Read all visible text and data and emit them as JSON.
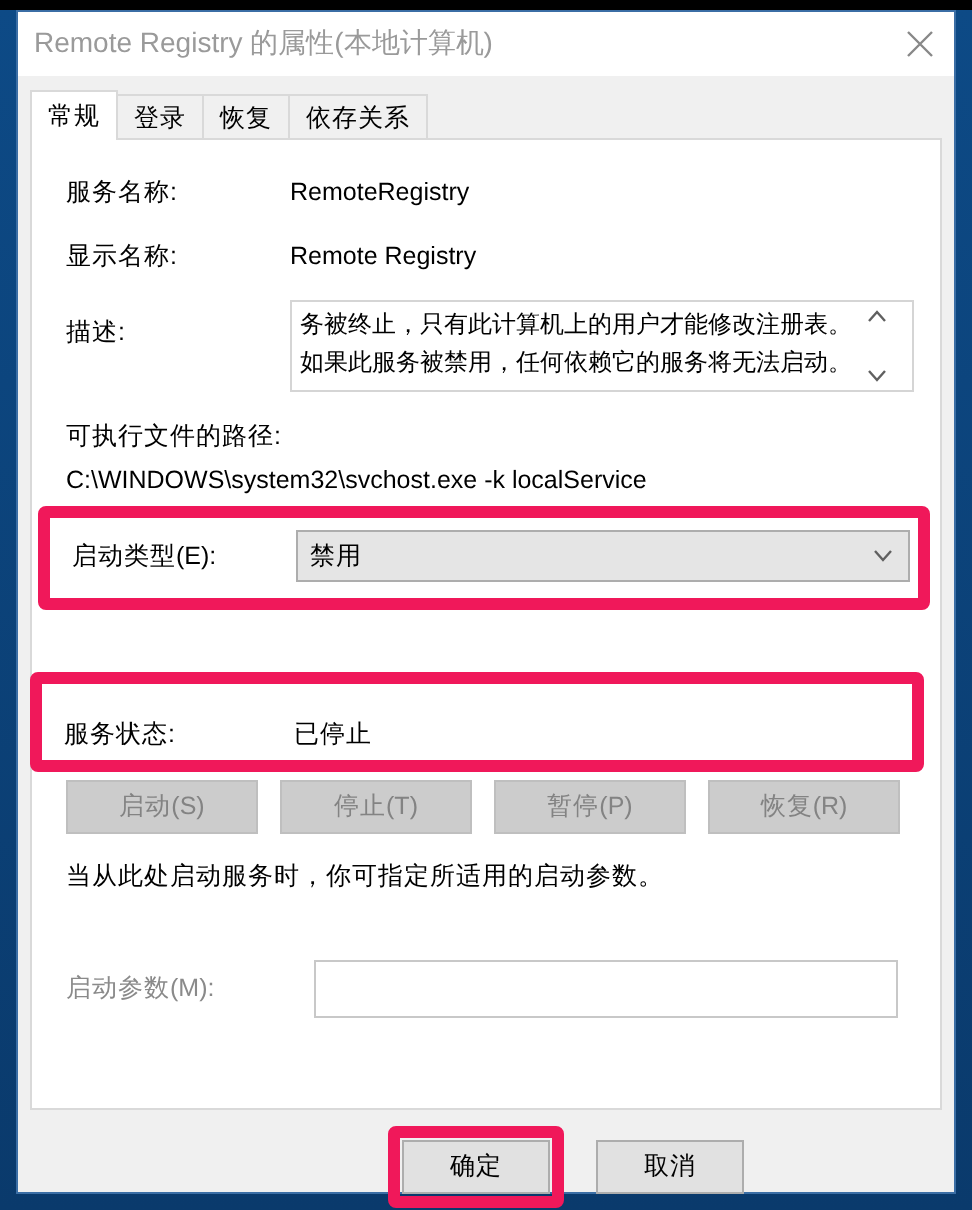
{
  "window": {
    "title": "Remote Registry 的属性(本地计算机)"
  },
  "tabs": [
    {
      "label": "常规",
      "selected": true
    },
    {
      "label": "登录",
      "selected": false
    },
    {
      "label": "恢复",
      "selected": false
    },
    {
      "label": "依存关系",
      "selected": false
    }
  ],
  "service_name": {
    "label": "服务名称:",
    "value": "RemoteRegistry"
  },
  "display_name": {
    "label": "显示名称:",
    "value": "Remote Registry"
  },
  "description": {
    "label": "描述:",
    "value": "务被终止，只有此计算机上的用户才能修改注册表。如果此服务被禁用，任何依赖它的服务将无法启动。"
  },
  "executable_path": {
    "label": "可执行文件的路径:",
    "value": "C:\\WINDOWS\\system32\\svchost.exe -k localService"
  },
  "startup_type": {
    "label": "启动类型(E):",
    "value": "禁用",
    "highlighted": true
  },
  "service_status": {
    "label": "服务状态:",
    "value": "已停止",
    "highlighted": true
  },
  "service_buttons": [
    {
      "label": "启动(S)",
      "disabled": true
    },
    {
      "label": "停止(T)",
      "disabled": true
    },
    {
      "label": "暂停(P)",
      "disabled": true
    },
    {
      "label": "恢复(R)",
      "disabled": true
    }
  ],
  "hint": "当从此处启动服务时，你可指定所适用的启动参数。",
  "start_parameters": {
    "label": "启动参数(M):",
    "disabled": true
  },
  "footer_buttons": [
    {
      "label": "确定",
      "highlighted": true
    },
    {
      "label": "取消",
      "highlighted": false
    }
  ]
}
